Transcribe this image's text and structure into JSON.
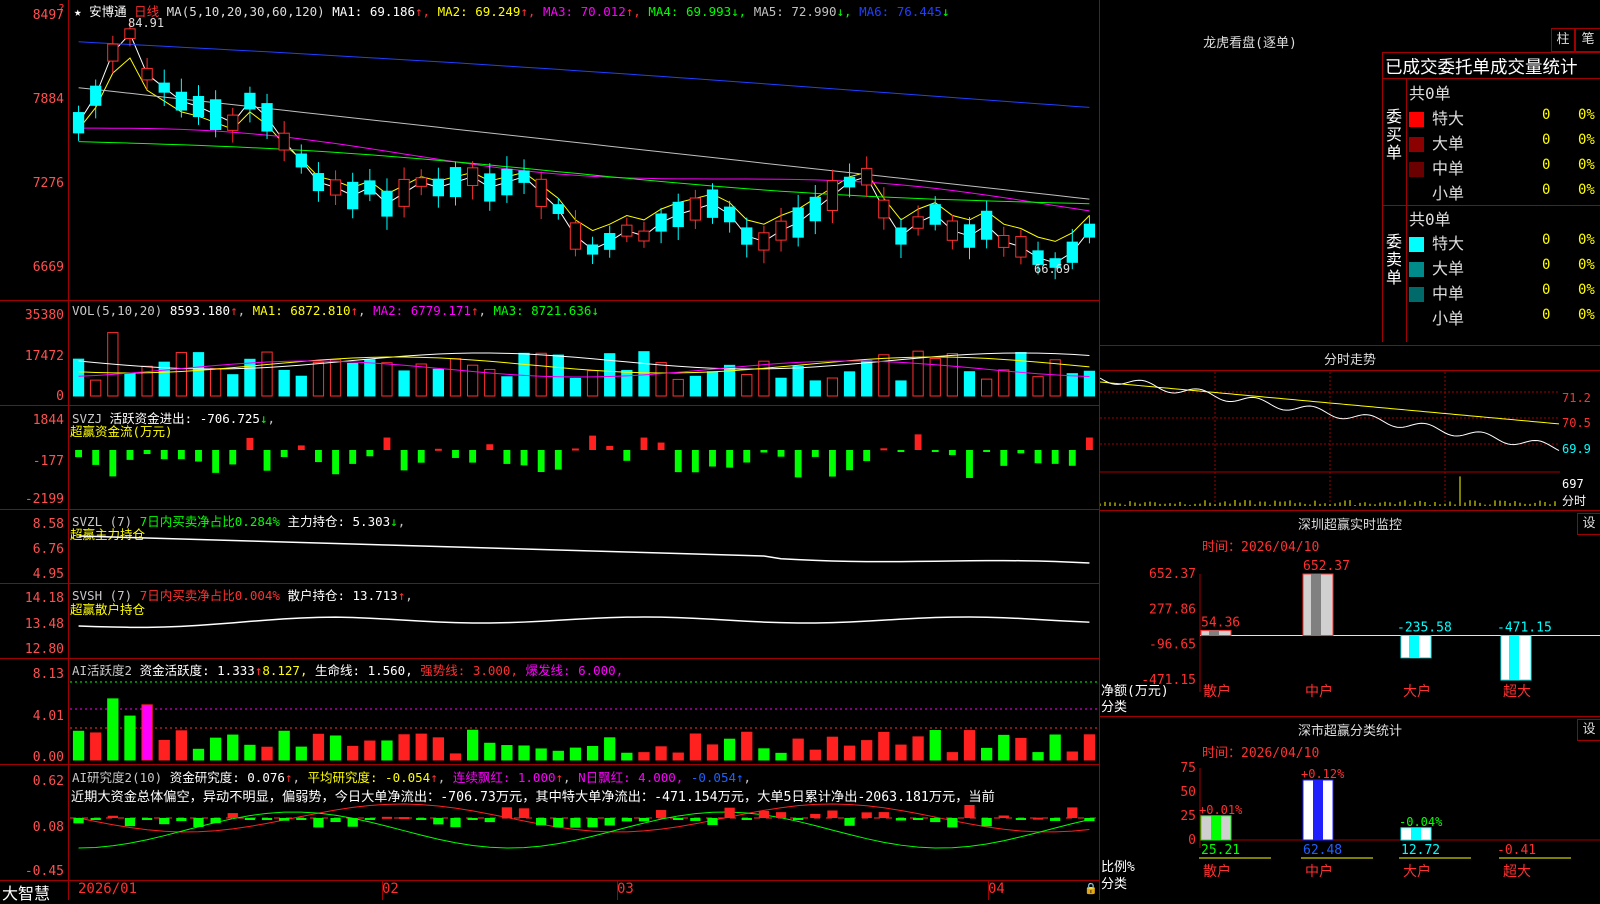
{
  "main": {
    "stock_name": "安博通",
    "period": "日线",
    "ma_label": "MA(5,10,20,30,60,120)",
    "ma": [
      {
        "name": "MA1:",
        "value": "69.186",
        "arrow": "↑",
        "color": "#ffffff"
      },
      {
        "name": "MA2:",
        "value": "69.249",
        "arrow": "↑",
        "color": "#ffff00"
      },
      {
        "name": "MA3:",
        "value": "70.012",
        "arrow": "↑",
        "color": "#ff00ff"
      },
      {
        "name": "MA4:",
        "value": "69.993",
        "arrow": "↓",
        "color": "#00ff00"
      },
      {
        "name": "MA5:",
        "value": "72.990",
        "arrow": "↓",
        "color": "#c0c0c0"
      },
      {
        "name": "MA6:",
        "value": "76.445",
        "arrow": "↓",
        "color": "#2040ff"
      }
    ],
    "y_labels": [
      "8497",
      "7884",
      "7276",
      "6669"
    ],
    "high_mark": "84.91",
    "low_mark": "66.69"
  },
  "vol": {
    "label": "VOL(5,10,20)",
    "value": "8593.180",
    "ma1": "MA1: 6872.810",
    "ma2": "MA2: 6779.171",
    "ma3": "MA3: 8721.636",
    "y_labels": [
      "35380",
      "17472",
      "0"
    ]
  },
  "svzj": {
    "label": "SVZJ",
    "text": "活跃资金进出: -706.725",
    "sub": "超赢资金流(万元)",
    "y_labels": [
      "1844",
      "-177",
      "-2199"
    ]
  },
  "svzl": {
    "label": "SVZL (7)",
    "text1": "7日内买卖净占比0.284%",
    "text2": "主力持仓: 5.303",
    "sub": "超赢主力持仓",
    "y_labels": [
      "8.58",
      "6.76",
      "4.95"
    ]
  },
  "svsh": {
    "label": "SVSH (7)",
    "text1": "7日内买卖净占比0.004%",
    "text2": "散户持仓: 13.713",
    "sub": "超赢散户持仓",
    "y_labels": [
      "14.18",
      "13.48",
      "12.80"
    ]
  },
  "ai1": {
    "label": "AI活跃度2",
    "t1": "资金活跃度: 1.333",
    "t2": "8.127,",
    "t3": "生命线: 1.560,",
    "t4": "强势线: 3.000,",
    "t5": "爆发线: 6.000,",
    "y_labels": [
      "8.13",
      "4.01",
      "0.00"
    ]
  },
  "ai2": {
    "label": "AI研究度2(10)",
    "t1": "资金研究度: 0.076",
    "t2": "平均研究度: -0.054",
    "t3": "连续飘红: 1.000",
    "t4": "N日飘红: 4.000,",
    "t5": "-0.054",
    "desc": "近期大资金总体偏空，异动不明显，偏弱势，今日大单净流出：-706.73万元，其中特大单净流出：-471.154万元，大单5日累计净出-2063.181万元，当前",
    "y_labels": [
      "0.62",
      "0.08",
      "-0.45"
    ]
  },
  "xaxis": {
    "labels": [
      "2026/01",
      "02",
      "03",
      "04"
    ],
    "brand": "大智慧"
  },
  "right": {
    "btn_col": "柱",
    "btn_bi": "笔",
    "lhb_title": "龙虎看盘(逐单)",
    "table_title": "已成交委托单成交量统计",
    "buy_side": "委买单",
    "sell_side": "委卖单",
    "buy_total": "共0单",
    "sell_total": "共0单",
    "buy_rows": [
      {
        "label": "特大",
        "n": "0",
        "p": "0%",
        "color": "#ff0000"
      },
      {
        "label": "大单",
        "n": "0",
        "p": "0%",
        "color": "#8b0000"
      },
      {
        "label": "中单",
        "n": "0",
        "p": "0%",
        "color": "#6a0000"
      },
      {
        "label": "小单",
        "n": "0",
        "p": "0%",
        "color": ""
      }
    ],
    "sell_rows": [
      {
        "label": "特大",
        "n": "0",
        "p": "0%",
        "color": "#00ffff"
      },
      {
        "label": "大单",
        "n": "0",
        "p": "0%",
        "color": "#008b8b"
      },
      {
        "label": "中单",
        "n": "0",
        "p": "0%",
        "color": "#006a6a"
      },
      {
        "label": "小单",
        "n": "0",
        "p": "0%",
        "color": ""
      }
    ],
    "intraday_title": "分时走势",
    "intraday_labels": [
      "71.2",
      "70.5",
      "69.9",
      "697",
      "分时"
    ],
    "monitor_title": "深圳超赢实时监控",
    "settings": "设",
    "time_label": "时间：2026/04/10",
    "monitor_ylabels": [
      "652.37",
      "277.86",
      "-96.65",
      "-471.15"
    ],
    "net_label": "净额(万元)",
    "cat_label": "分类",
    "categories": [
      "散户",
      "中户",
      "大户",
      "超大"
    ],
    "monitor_values": [
      "54.36",
      "652.37",
      "-235.58",
      "-471.15"
    ],
    "class_title": "深市超赢分类统计",
    "class_ylabels": [
      "75",
      "50",
      "25",
      "0"
    ],
    "ratio_label": "比例%",
    "class_pct": [
      "+0.01%",
      "+0.12%",
      "-0.04%",
      ""
    ],
    "class_values": [
      "25.21",
      "62.48",
      "12.72",
      "-0.41"
    ]
  },
  "chart_data": [
    {
      "type": "bar",
      "title": "深圳超赢实时监控",
      "categories": [
        "散户",
        "中户",
        "大户",
        "超大"
      ],
      "values": [
        54.36,
        652.37,
        -235.58,
        -471.15
      ],
      "ylabel": "净额(万元)",
      "ylim": [
        -471.15,
        652.37
      ]
    },
    {
      "type": "bar",
      "title": "深市超赢分类统计",
      "categories": [
        "散户",
        "中户",
        "大户",
        "超大"
      ],
      "values": [
        25.21,
        62.48,
        12.72,
        -0.41
      ],
      "ylabel": "比例%",
      "ylim": [
        0,
        75
      ]
    }
  ]
}
